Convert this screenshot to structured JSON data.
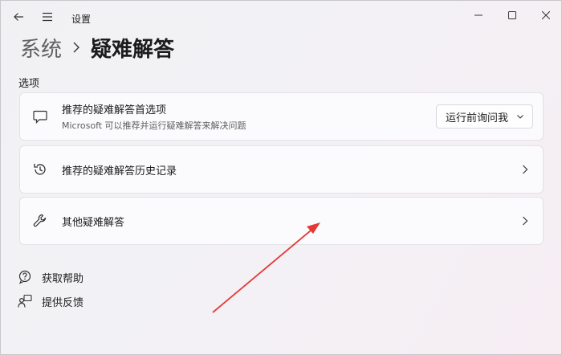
{
  "window": {
    "title": "设置"
  },
  "icons": {
    "back": "back-arrow-icon",
    "menu": "hamburger-menu-icon",
    "minimize": "minimize-icon",
    "maximize": "maximize-icon",
    "close": "close-icon"
  },
  "breadcrumb": {
    "parent": "系统",
    "current": "疑难解答"
  },
  "section": {
    "label": "选项"
  },
  "cards": [
    {
      "icon": "chat-bubble-icon",
      "title": "推荐的疑难解答首选项",
      "subtitle": "Microsoft 可以推荐并运行疑难解答来解决问题",
      "dropdown_value": "运行前询问我"
    },
    {
      "icon": "history-icon",
      "title": "推荐的疑难解答历史记录"
    },
    {
      "icon": "wrench-icon",
      "title": "其他疑难解答"
    }
  ],
  "links": [
    {
      "icon": "help-icon",
      "label": "获取帮助"
    },
    {
      "icon": "feedback-icon",
      "label": "提供反馈"
    }
  ],
  "annotation": {
    "color": "#e53935"
  }
}
